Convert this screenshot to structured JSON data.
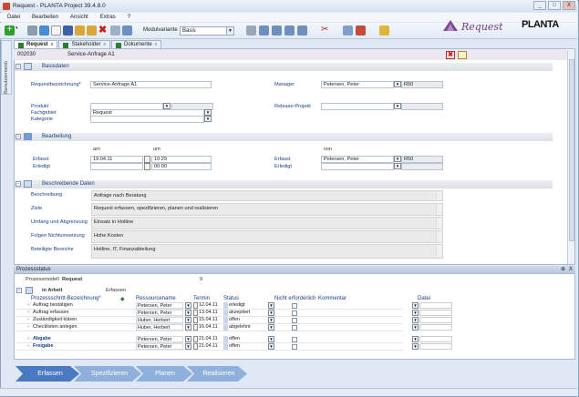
{
  "window": {
    "title": "Request - PLANTA Project 39.4.8.0",
    "minimize": "_",
    "maximize": "□",
    "close": "X"
  },
  "menu": [
    "Datei",
    "Bearbeiten",
    "Ansicht",
    "Extras",
    "?"
  ],
  "toolbar": {
    "modulvariante_label": "Modulvariante",
    "modulvariante_value": "Basis"
  },
  "brand": {
    "module": "Request",
    "logo": "PLANTA"
  },
  "side_tab": "Benutzermenü",
  "tabs": [
    {
      "label": "Request"
    },
    {
      "label": "Stakeholder"
    },
    {
      "label": "Dokumente"
    }
  ],
  "header": {
    "id": "002030",
    "title": "Service-Anfrage A1"
  },
  "sections": {
    "basis": "Basisdaten",
    "bearbeitung": "Bearbeitung",
    "beschreibend": "Beschreibende Daten"
  },
  "basis": {
    "requestbez_label": "Requestbezeichnung*",
    "requestbez_value": "Service-Anfrage A1",
    "manager_label": "Manager",
    "manager_value": "Petersen, Peter",
    "manager_code": "R50",
    "produkt_label": "Produkt",
    "fachgebiet_label": "Fachgebiet",
    "fachgebiet_value": "Request",
    "kategorie_label": "Kategorie",
    "release_label": "Release-Projekt"
  },
  "bearbeitung": {
    "am": "am",
    "um": "um",
    "von": "von",
    "erfasst_label": "Erfasst",
    "erfasst_date": "19.04.11",
    "erfasst_time": "10:29",
    "erledigt_label": "Erledigt",
    "erledigt_time": "00:00",
    "erfasst2_label": "Erfasst",
    "erfasst2_value": "Petersen, Peter",
    "erfasst2_code": "R50",
    "erledigt2_label": "Erledigt"
  },
  "beschreibend": [
    {
      "label": "Beschreibung",
      "value": "Anfrage nach Beratung"
    },
    {
      "label": "Ziele",
      "value": "Request erfassen, spezifizieren, planen und realisieren"
    },
    {
      "label": "Umfang und Abgrenzung",
      "value": "Einsatz in Hotline"
    },
    {
      "label": "Folgen Nichtumsetzung",
      "value": "Hohe Kosten"
    },
    {
      "label": "Beteiligte Bereiche",
      "value": "Hotline, IT, Finanzabteilung"
    }
  ],
  "prozessstatus": {
    "title": "Prozessstatus",
    "pin": "⊕",
    "close": "X",
    "modell_label": "Prozessmodell",
    "modell_value": "Request",
    "modell_nr": "9",
    "phase_label": "in Arbeit",
    "phase_status": "Erfassen",
    "columns": [
      "Prozessschritt-Bezeichnung*",
      "Ressourcename",
      "Termin",
      "Status",
      "Nicht erforderlich",
      "Kommentar",
      "Datei"
    ],
    "rows": [
      {
        "step": "Auftrag bestätigen",
        "ressource": "Petersen, Peter",
        "termin": "12.04.11",
        "status": "erledigt"
      },
      {
        "step": "Auftrag erfassen",
        "ressource": "Petersen, Peter",
        "termin": "13.04.11",
        "status": "akzeptiert"
      },
      {
        "step": "Zuständigkeit klären",
        "ressource": "Huber, Herbert",
        "termin": "15.04.11",
        "status": "offen"
      },
      {
        "step": "Checklisten anlegen",
        "ressource": "Huber, Herbert",
        "termin": "16.04.11",
        "status": "abgelehnt"
      },
      {
        "step": "Abgabe",
        "ressource": "Petersen, Peter",
        "termin": "21.04.11",
        "status": "offen"
      },
      {
        "step": "Freigabe",
        "ressource": "Petersen, Peter",
        "termin": "21.04.11",
        "status": "offen"
      }
    ]
  },
  "workflow": [
    "Erfassen",
    "Spezifizieren",
    "Planen",
    "Realisieren"
  ],
  "colors": {
    "accent": "#1b3f86",
    "workflow_active": "#4a79c4",
    "workflow_inactive": "#8fb0db",
    "brand": "#7a4b92"
  }
}
